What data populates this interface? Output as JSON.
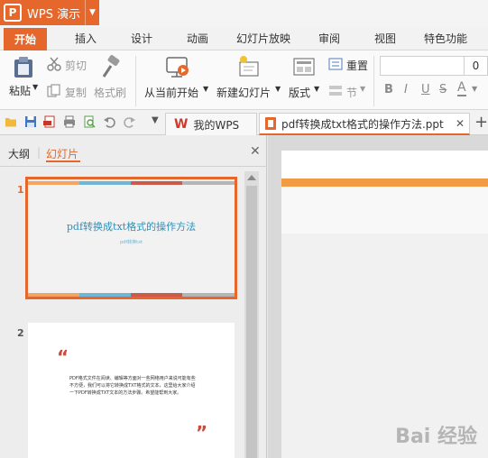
{
  "app": {
    "title": "WPS 演示",
    "logo_glyph": "P",
    "accent_color": "#e5672b"
  },
  "menu_tabs": [
    {
      "label": "开始",
      "active": true
    },
    {
      "label": "插入"
    },
    {
      "label": "设计"
    },
    {
      "label": "动画"
    },
    {
      "label": "幻灯片放映"
    },
    {
      "label": "审阅"
    },
    {
      "label": "视图"
    },
    {
      "label": "特色功能"
    }
  ],
  "ribbon": {
    "paste": "粘贴",
    "cut": "剪切",
    "copy": "复制",
    "format_painter": "格式刷",
    "from_current": "从当前开始",
    "new_slide": "新建幻灯片",
    "layout": "版式",
    "reset": "重置",
    "section": "节",
    "font_size": "0",
    "fmt": [
      "B",
      "I",
      "U",
      "S",
      "A"
    ]
  },
  "tabs": [
    {
      "label": "我的WPS"
    },
    {
      "label": "pdf转换成txt格式的操作方法.ppt",
      "active": true
    }
  ],
  "left_pane": {
    "tabs": [
      {
        "label": "大纲"
      },
      {
        "label": "幻灯片",
        "active": true
      }
    ],
    "slides": [
      {
        "number": "1",
        "title": "pdf转换成txt格式的操作方法",
        "subtitle": "pdf转换txt"
      },
      {
        "number": "2",
        "open_quote": "“",
        "close_quote": "”",
        "body": "PDF格式文件在阅读、编辑等方面对一些网络用户来说可能有些不方便，我们可以将它转换成TXT格式的文本，这里给大家介绍一下PDF转换成TXT文本的方法步骤。希望能帮到大家。"
      }
    ]
  },
  "watermark": "Bai 经验"
}
